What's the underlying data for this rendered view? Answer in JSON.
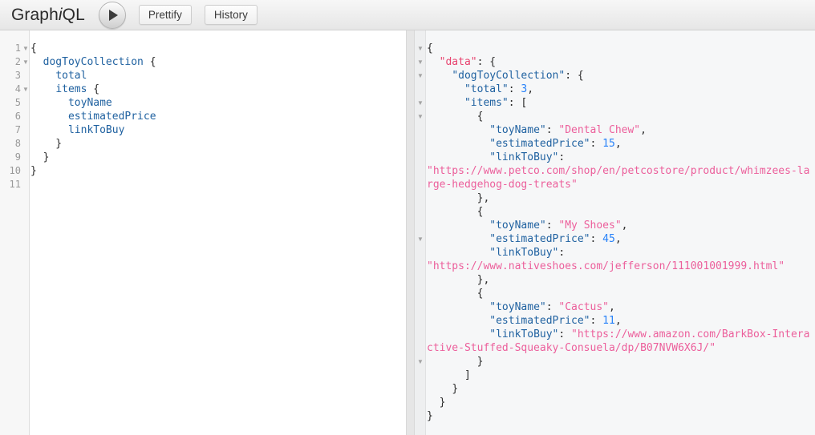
{
  "app": {
    "logo_prefix": "Graph",
    "logo_italic": "i",
    "logo_suffix": "QL"
  },
  "toolbar": {
    "execute_label": "execute-query",
    "prettify_label": "Prettify",
    "history_label": "History"
  },
  "query_editor": {
    "line_numbers": [
      "1",
      "2",
      "3",
      "4",
      "5",
      "6",
      "7",
      "8",
      "9",
      "10",
      "11"
    ],
    "fold_lines": [
      1,
      2,
      4
    ],
    "fold_glyph": "▼",
    "lines": [
      [
        {
          "t": "punc",
          "v": "{"
        }
      ],
      [
        {
          "t": "punc",
          "v": "  "
        },
        {
          "t": "field",
          "v": "dogToyCollection"
        },
        {
          "t": "punc",
          "v": " {"
        }
      ],
      [
        {
          "t": "punc",
          "v": "    "
        },
        {
          "t": "field",
          "v": "total"
        }
      ],
      [
        {
          "t": "punc",
          "v": "    "
        },
        {
          "t": "field",
          "v": "items"
        },
        {
          "t": "punc",
          "v": " {"
        }
      ],
      [
        {
          "t": "punc",
          "v": "      "
        },
        {
          "t": "field",
          "v": "toyName"
        }
      ],
      [
        {
          "t": "punc",
          "v": "      "
        },
        {
          "t": "field",
          "v": "estimatedPrice"
        }
      ],
      [
        {
          "t": "punc",
          "v": "      "
        },
        {
          "t": "field",
          "v": "linkToBuy"
        }
      ],
      [
        {
          "t": "punc",
          "v": "    }"
        }
      ],
      [
        {
          "t": "punc",
          "v": "  }"
        }
      ],
      [
        {
          "t": "punc",
          "v": "}"
        }
      ],
      []
    ]
  },
  "result_viewer": {
    "fold_rows": [
      0,
      1,
      2,
      4,
      5,
      13,
      21
    ],
    "fold_glyph": "▼",
    "lines": [
      [
        {
          "t": "punc",
          "v": "{"
        }
      ],
      [
        {
          "t": "punc",
          "v": "  "
        },
        {
          "t": "key-root",
          "v": "\"data\""
        },
        {
          "t": "punc",
          "v": ": {"
        }
      ],
      [
        {
          "t": "punc",
          "v": "    "
        },
        {
          "t": "key",
          "v": "\"dogToyCollection\""
        },
        {
          "t": "punc",
          "v": ": {"
        }
      ],
      [
        {
          "t": "punc",
          "v": "      "
        },
        {
          "t": "key",
          "v": "\"total\""
        },
        {
          "t": "punc",
          "v": ": "
        },
        {
          "t": "num",
          "v": "3"
        },
        {
          "t": "punc",
          "v": ","
        }
      ],
      [
        {
          "t": "punc",
          "v": "      "
        },
        {
          "t": "key",
          "v": "\"items\""
        },
        {
          "t": "punc",
          "v": ": ["
        }
      ],
      [
        {
          "t": "punc",
          "v": "        {"
        }
      ],
      [
        {
          "t": "punc",
          "v": "          "
        },
        {
          "t": "key",
          "v": "\"toyName\""
        },
        {
          "t": "punc",
          "v": ": "
        },
        {
          "t": "str",
          "v": "\"Dental Chew\""
        },
        {
          "t": "punc",
          "v": ","
        }
      ],
      [
        {
          "t": "punc",
          "v": "          "
        },
        {
          "t": "key",
          "v": "\"estimatedPrice\""
        },
        {
          "t": "punc",
          "v": ": "
        },
        {
          "t": "num",
          "v": "15"
        },
        {
          "t": "punc",
          "v": ","
        }
      ],
      [
        {
          "t": "punc",
          "v": "          "
        },
        {
          "t": "key",
          "v": "\"linkToBuy\""
        },
        {
          "t": "punc",
          "v": ": "
        }
      ],
      [
        {
          "t": "str",
          "v": "\"https://www.petco.com/shop/en/petcostore/product/whimzees-large-hedgehog-dog-treats\""
        }
      ],
      [
        {
          "t": "punc",
          "v": "        },"
        }
      ],
      [
        {
          "t": "punc",
          "v": "        {"
        }
      ],
      [
        {
          "t": "punc",
          "v": "          "
        },
        {
          "t": "key",
          "v": "\"toyName\""
        },
        {
          "t": "punc",
          "v": ": "
        },
        {
          "t": "str",
          "v": "\"My Shoes\""
        },
        {
          "t": "punc",
          "v": ","
        }
      ],
      [
        {
          "t": "punc",
          "v": "          "
        },
        {
          "t": "key",
          "v": "\"estimatedPrice\""
        },
        {
          "t": "punc",
          "v": ": "
        },
        {
          "t": "num",
          "v": "45"
        },
        {
          "t": "punc",
          "v": ","
        }
      ],
      [
        {
          "t": "punc",
          "v": "          "
        },
        {
          "t": "key",
          "v": "\"linkToBuy\""
        },
        {
          "t": "punc",
          "v": ": "
        }
      ],
      [
        {
          "t": "str",
          "v": "\"https://www.nativeshoes.com/jefferson/111001001999.html\""
        }
      ],
      [
        {
          "t": "punc",
          "v": "        },"
        }
      ],
      [
        {
          "t": "punc",
          "v": "        {"
        }
      ],
      [
        {
          "t": "punc",
          "v": "          "
        },
        {
          "t": "key",
          "v": "\"toyName\""
        },
        {
          "t": "punc",
          "v": ": "
        },
        {
          "t": "str",
          "v": "\"Cactus\""
        },
        {
          "t": "punc",
          "v": ","
        }
      ],
      [
        {
          "t": "punc",
          "v": "          "
        },
        {
          "t": "key",
          "v": "\"estimatedPrice\""
        },
        {
          "t": "punc",
          "v": ": "
        },
        {
          "t": "num",
          "v": "11"
        },
        {
          "t": "punc",
          "v": ","
        }
      ],
      [
        {
          "t": "punc",
          "v": "          "
        },
        {
          "t": "key",
          "v": "\"linkToBuy\""
        },
        {
          "t": "punc",
          "v": ": "
        },
        {
          "t": "str",
          "v": "\"https://www.amazon.com/BarkBox-Interactive-Stuffed-Squeaky-Consuela/dp/B07NVW6X6J/\""
        }
      ],
      [
        {
          "t": "punc",
          "v": "        }"
        }
      ],
      [
        {
          "t": "punc",
          "v": "      ]"
        }
      ],
      [
        {
          "t": "punc",
          "v": "    }"
        }
      ],
      [
        {
          "t": "punc",
          "v": "  }"
        }
      ],
      [
        {
          "t": "punc",
          "v": "}"
        }
      ]
    ]
  },
  "colors": {
    "field": "#1f61a0",
    "key": "#1f61a0",
    "key_root": "#e8436f",
    "string": "#ec5f9b",
    "number": "#2882f9",
    "punctuation": "#2b2b2b",
    "result_background": "#f6f7f8",
    "editor_background": "#ffffff"
  }
}
